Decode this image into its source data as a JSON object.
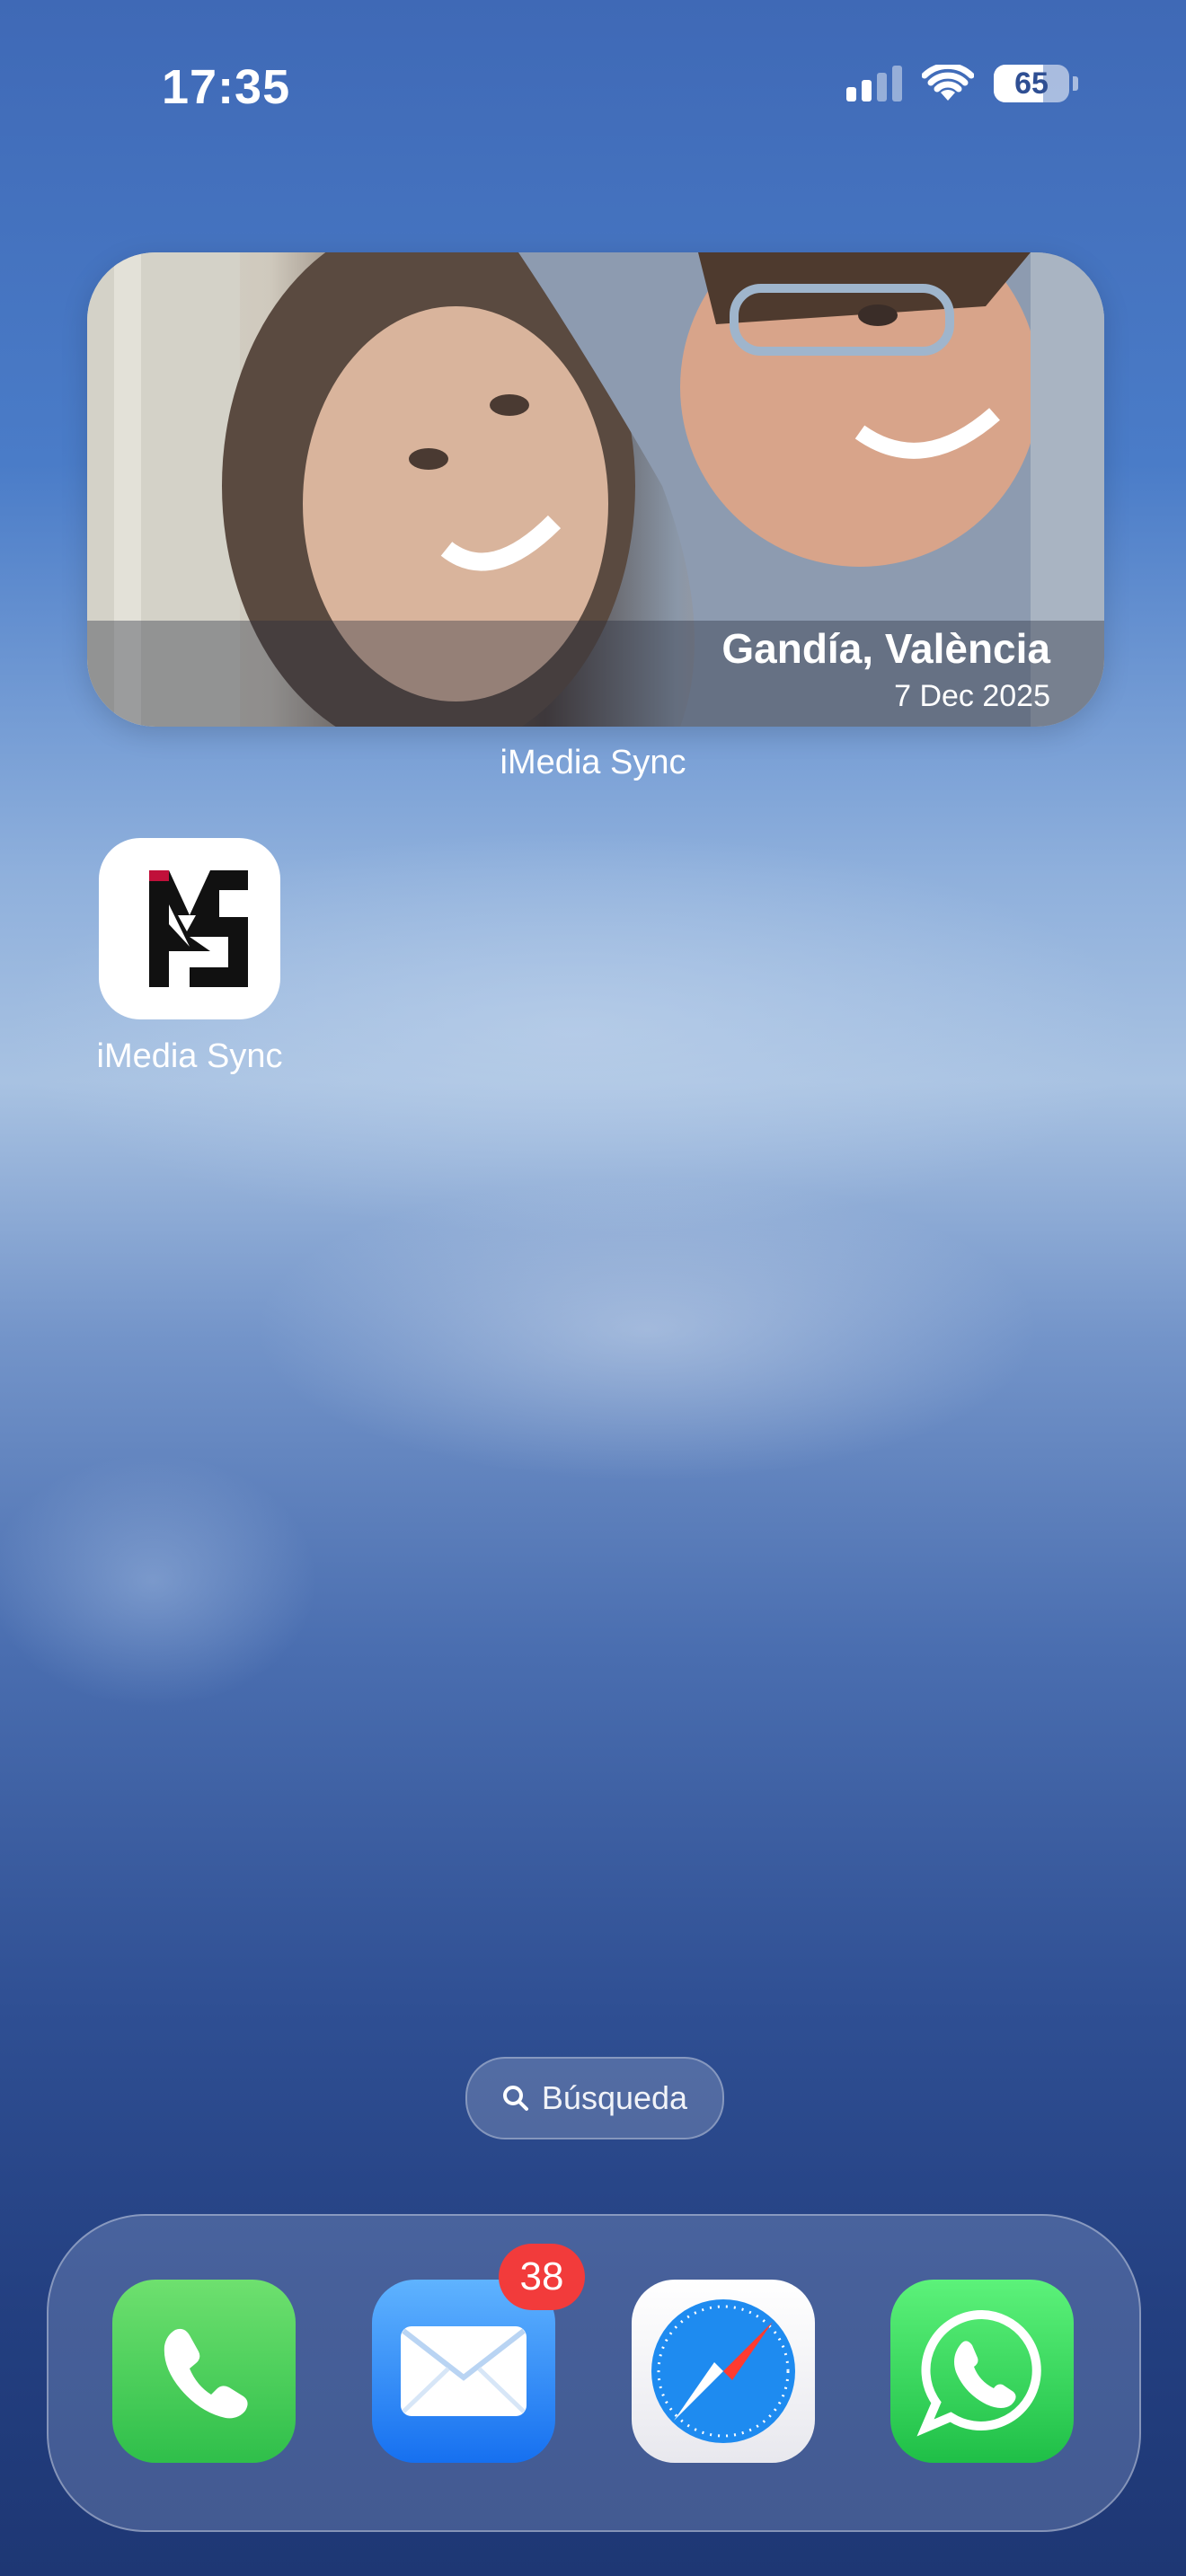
{
  "status_bar": {
    "time": "17:35",
    "battery_percent": "65",
    "battery_level": 0.65,
    "signal_bars_active": 2,
    "signal_bars_total": 4
  },
  "widget": {
    "place": "Gandía, València",
    "date": "7 Dec 2025",
    "label": "iMedia Sync"
  },
  "apps": [
    {
      "label": "iMedia Sync",
      "icon": "imedia-sync-logo-icon"
    }
  ],
  "search": {
    "label": "Búsqueda",
    "icon": "search-icon"
  },
  "dock": {
    "items": [
      {
        "name": "phone",
        "icon": "phone-icon",
        "color": "#34c759"
      },
      {
        "name": "mail",
        "icon": "mail-icon",
        "color": "#1a82fb",
        "badge": "38"
      },
      {
        "name": "safari",
        "icon": "compass-icon",
        "color": "#1e8bf0"
      },
      {
        "name": "whatsapp",
        "icon": "whatsapp-icon",
        "color": "#25d366"
      }
    ]
  },
  "colors": {
    "badge": "#f23b3b",
    "wallpaper_top": "#3f69b6",
    "wallpaper_bottom": "#1e3774"
  }
}
